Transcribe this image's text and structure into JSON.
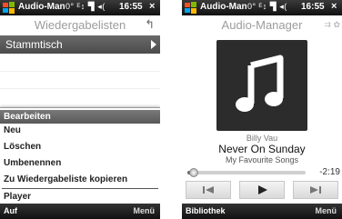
{
  "statusbar": {
    "app_title": "Audio-Man",
    "status_icons": "0° ᴱ↕ ▜ ◂(",
    "time": "16:55",
    "close": "×"
  },
  "screen1": {
    "header_title": "Wiedergabelisten",
    "back_glyph": "↰",
    "playlist": "Stammtisch",
    "menu": [
      {
        "label": "Bearbeiten",
        "selected": true
      },
      {
        "label": "Neu"
      },
      {
        "label": "Löschen"
      },
      {
        "label": "Umbenennen"
      },
      {
        "label": "Zu Wiedergabeliste kopieren"
      },
      {
        "label": "Player"
      }
    ],
    "softkey_left": "Auf",
    "softkey_right": "Menü"
  },
  "screen2": {
    "header_title": "Audio-Manager",
    "header_icons": "⇉ ✿",
    "artist": "Billy Vau",
    "track": "Never On Sunday",
    "album": "My Favourite Songs",
    "progress": 0.05,
    "time_remaining": "-2:19",
    "softkey_left": "Bibliothek",
    "softkey_right": "Menü"
  },
  "colors": {
    "statusbar": "#1e1e1e",
    "selected_item": "#666666",
    "album_art": "#2c2c2c"
  },
  "icons": {
    "logo": "windows-flag-icon",
    "album_art": "music-note-icon",
    "prev": "previous-track-icon",
    "play": "play-icon",
    "next": "next-track-icon"
  }
}
